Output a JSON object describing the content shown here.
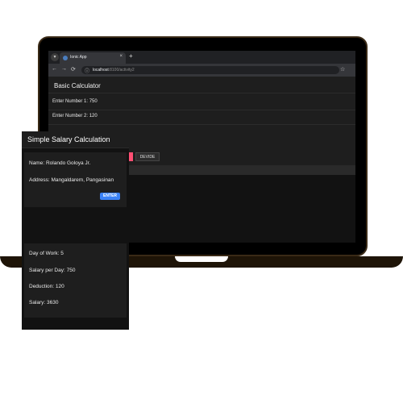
{
  "browser": {
    "tab_title": "Ionic App",
    "tab_close": "×",
    "new_tab": "+",
    "menu_icon": "chevron-down-icon",
    "url_host": "localhost",
    "url_path": ":8100/activity2",
    "nav": {
      "back": "←",
      "forward": "→",
      "reload": "⟳"
    },
    "info_icon": "ⓘ",
    "bookmark_icon": "☆"
  },
  "calculator": {
    "title": "Basic Calculator",
    "number1_label": "Enter Number 1:",
    "number1_value": "750",
    "number2_label": "Enter Number 2:",
    "number2_value": "120",
    "buttons": {
      "divide": "DEVIDE"
    },
    "colors": {
      "add": "#2ecc71",
      "subtract": "#f6d44a",
      "multiply": "#ff4f73"
    }
  },
  "salary_app": {
    "title": "Simple Salary Calculation",
    "name_label": "Name:",
    "name_value": "Rolando Goloya Jr.",
    "address_label": "Address:",
    "address_value": "Mangaldarem, Pangasinan",
    "enter_button": "ENTER",
    "days_label": "Day of Work:",
    "days_value": "5",
    "rate_label": "Salary per Day:",
    "rate_value": "750",
    "deduction_label": "Deduction:",
    "deduction_value": "120",
    "salary_label": "Salary:",
    "salary_value": "3630",
    "accent_color": "#3b82f6"
  }
}
